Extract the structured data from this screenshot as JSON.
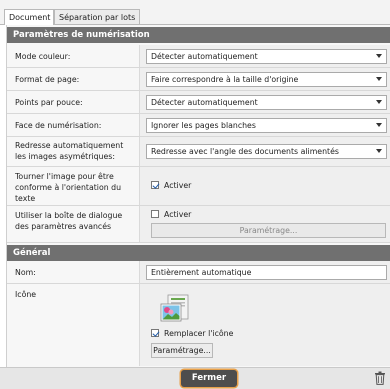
{
  "tabs": [
    {
      "label": "Document"
    },
    {
      "label": "Séparation par lots"
    }
  ],
  "sections": {
    "scan_params": "Paramètres de numérisation",
    "general": "Général"
  },
  "fields": {
    "color_mode": {
      "label": "Mode couleur:",
      "value": "Détecter automatiquement"
    },
    "page_format": {
      "label": "Format de page:",
      "value": "Faire correspondre à la taille d'origine"
    },
    "dpi": {
      "label": "Points par pouce:",
      "value": "Détecter automatiquement"
    },
    "scan_face": {
      "label": "Face de numérisation:",
      "value": "Ignorer les pages blanches"
    },
    "deskew": {
      "label": "Redresse automatiquement les images asymétriques:",
      "value": "Redresse avec l'angle des documents alimentés"
    },
    "rotate": {
      "label": "Tourner l'image pour être conforme à l'orientation du texte",
      "checkbox_label": "Activer",
      "checked": true
    },
    "advanced_dialog": {
      "label": "Utiliser la boîte de dialogue des paramètres avancés",
      "checkbox_label": "Activer",
      "checked": false,
      "button": "Paramétrage..."
    },
    "name": {
      "label": "Nom:",
      "value": "Entièrement automatique"
    },
    "icon": {
      "label": "Icône",
      "checkbox_label": "Remplacer l'icône",
      "checked": true,
      "button": "Paramétrage..."
    }
  },
  "footer": {
    "close": "Fermer",
    "accent": "#e7a04a"
  },
  "icons": [
    "chevron-down-icon",
    "checkmark-icon",
    "scanner-photo-icon",
    "trash-icon"
  ]
}
